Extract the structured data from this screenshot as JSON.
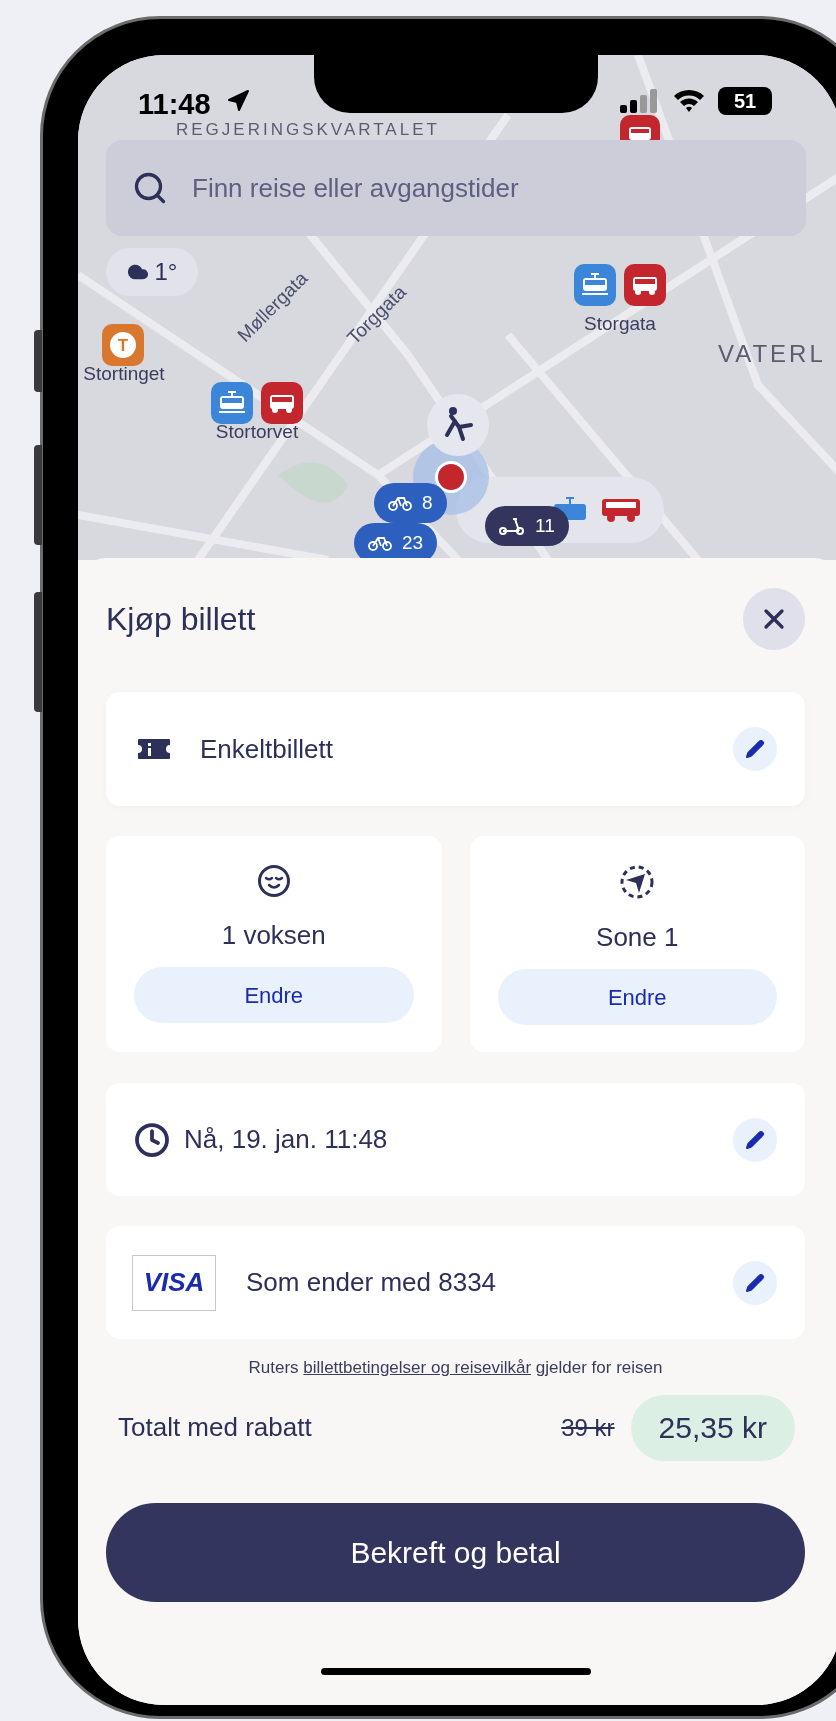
{
  "status_bar": {
    "time": "11:48",
    "battery": "51"
  },
  "map": {
    "search": {
      "placeholder": "Finn reise eller avgangstider"
    },
    "weather": "1°",
    "labels": [
      {
        "text": "REGJERINGSKVARTALET",
        "kind": "district"
      },
      {
        "text": "Møllergata",
        "kind": "street"
      },
      {
        "text": "Torggata",
        "kind": "street"
      },
      {
        "text": "VATERL",
        "kind": "district"
      }
    ],
    "stops": [
      {
        "name": "Storgata",
        "icons": [
          {
            "kind": "tram"
          },
          {
            "kind": "bus"
          }
        ]
      },
      {
        "name": "Stortorvet",
        "icons": [
          {
            "kind": "tram"
          },
          {
            "kind": "bus"
          }
        ]
      },
      {
        "name": "Stortinget",
        "icons": [
          {
            "kind": "metro"
          }
        ]
      }
    ],
    "metro_glyph": "T",
    "clusters": [
      {
        "kind": "bike",
        "count": "8"
      },
      {
        "kind": "bike",
        "count": "23"
      },
      {
        "kind": "scooter",
        "count": "11"
      }
    ]
  },
  "sheet": {
    "title": "Kjøp billett",
    "ticket_type": "Enkeltbillett",
    "choices": [
      {
        "kind": "travellers",
        "value": "1 voksen",
        "button": "Endre"
      },
      {
        "kind": "zone",
        "value": "Sone 1",
        "button": "Endre"
      }
    ],
    "time": "Nå, 19. jan. 11:48",
    "payment": {
      "card_brand": "VISA",
      "text": "Som ender med 8334"
    },
    "terms": {
      "before": "Ruters",
      "link": "billettbetingelser og reisevilkår",
      "after": "gjelder for reisen"
    },
    "total": {
      "label": "Totalt med rabatt",
      "original_price": "39 kr",
      "price": "25,35 kr"
    },
    "confirm_button": "Bekreft og betal"
  }
}
